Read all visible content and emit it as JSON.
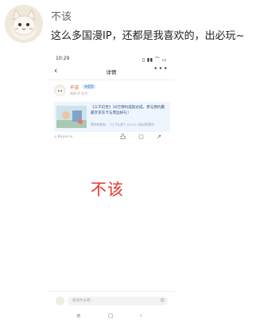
{
  "post": {
    "author": "不该",
    "text": "这么多国漫IP，还都是我喜欢的，出必玩~"
  },
  "screenshot": {
    "status_time": "10:29",
    "status_icons": "▯ ▮▮ ⌒ ▭",
    "nav_title": "详情",
    "back_icon": "‹",
    "more_icon": "•••",
    "inner_post": {
      "author": "不该",
      "badge": "★会员",
      "meta": "刚刚 IP 北京",
      "card_title": "《三千幻世》10万预约成就达成，参与预约赢最享京东卡与周边好礼！",
      "card_subtitle": "等你的参加 · 《三千幻世》10.0.0.0测试招募中",
      "footer": "◎ Bizyon.ia",
      "actions": "凸 ▢ ↗"
    },
    "watermark": "不该",
    "comment_placeholder": "说点什么吧...",
    "emoji_icon": "☺",
    "sys_nav": [
      "≡",
      "▢",
      "‹"
    ]
  }
}
